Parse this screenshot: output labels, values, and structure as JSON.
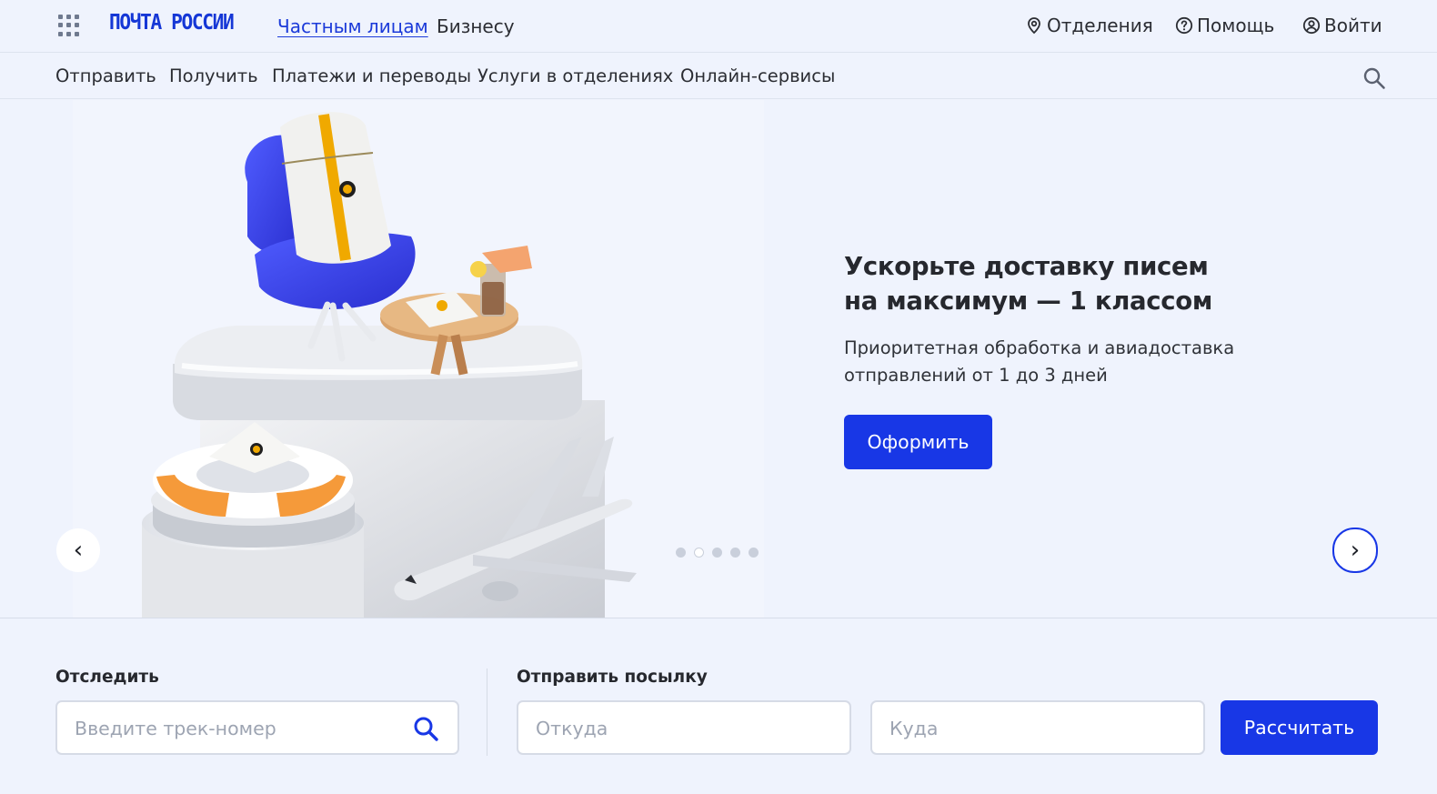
{
  "header": {
    "logo": "ПОЧТА РОССИИ",
    "segments": [
      {
        "label": "Частным лицам",
        "active": true
      },
      {
        "label": "Бизнесу",
        "active": false
      }
    ],
    "offices_label": "Отделения",
    "help_label": "Помощь",
    "login_label": "Войти"
  },
  "nav": {
    "items": [
      "Отправить",
      "Получить",
      "Платежи и переводы",
      "Услуги в отделениях",
      "Онлайн-сервисы"
    ]
  },
  "hero": {
    "title_line1": "Ускорьте доставку писем",
    "title_line2": "на максимум — 1 классом",
    "subtitle_line1": "Приоритетная обработка и авиадоставка",
    "subtitle_line2": "отправлений от 1 до 3 дней",
    "button_label": "Оформить",
    "prev_arrow": "‹",
    "next_arrow": "›",
    "slides_total": 5,
    "active_slide": 2
  },
  "track": {
    "label": "Отследить",
    "placeholder": "Введите трек-номер"
  },
  "send": {
    "label": "Отправить посылку",
    "from_placeholder": "Откуда",
    "to_placeholder": "Куда",
    "button_label": "Рассчитать"
  },
  "colors": {
    "brand_blue": "#1837e6",
    "background": "#eff3fd",
    "text": "#2b2d33"
  },
  "icons": [
    "apps-grid-icon",
    "location-pin-icon",
    "help-circle-icon",
    "user-circle-icon",
    "search-icon"
  ]
}
